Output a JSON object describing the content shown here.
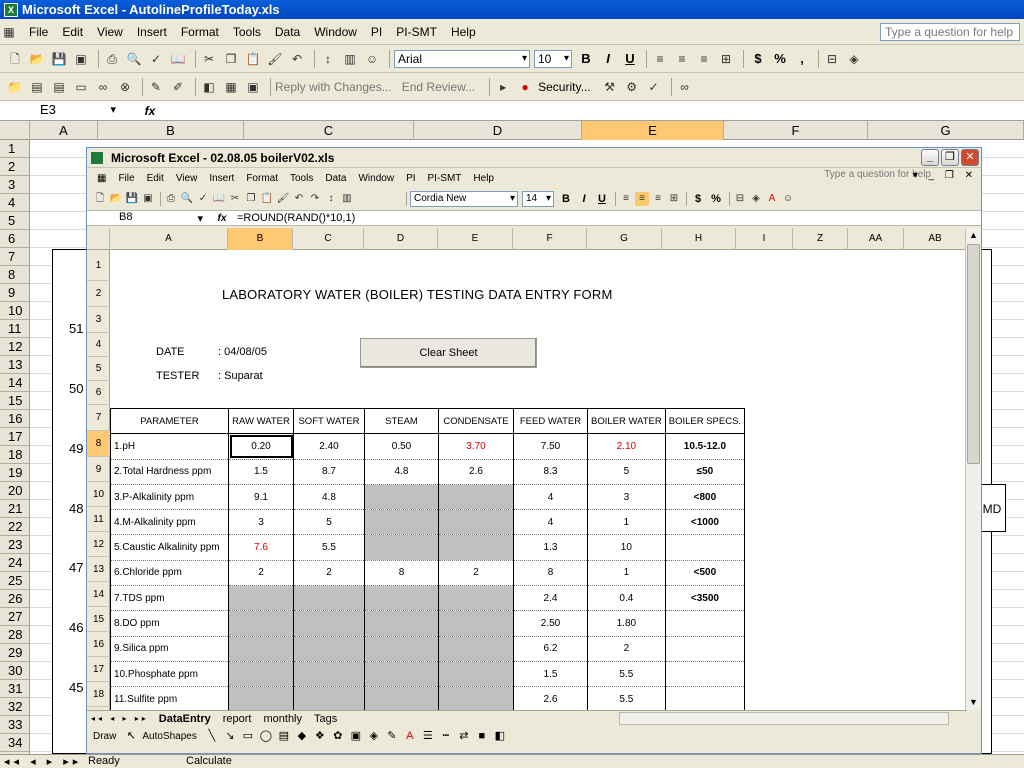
{
  "outer": {
    "title": "Microsoft Excel - AutolineProfileToday.xls",
    "menu": [
      "File",
      "Edit",
      "View",
      "Insert",
      "Format",
      "Tools",
      "Data",
      "Window",
      "PI",
      "PI-SMT",
      "Help"
    ],
    "ask_placeholder": "Type a question for help",
    "font": "Arial",
    "font_size": "10",
    "review": {
      "reply": "Reply with Changes...",
      "end_review": "End Review..."
    },
    "security": "Security...",
    "name_box": "E3",
    "fx": "fx",
    "columns": [
      "A",
      "B",
      "C",
      "D",
      "E",
      "F",
      "G"
    ],
    "rows": [
      "1",
      "2",
      "3",
      "4",
      "5",
      "6",
      "7",
      "8",
      "9",
      "10",
      "11",
      "12",
      "13",
      "14",
      "15",
      "16",
      "17",
      "18",
      "19",
      "20",
      "21",
      "22",
      "23",
      "24",
      "25",
      "26",
      "27",
      "28",
      "29",
      "30",
      "31",
      "32",
      "33",
      "34"
    ],
    "chart_y_labels": [
      "51",
      "50",
      "49",
      "48",
      "47",
      "46",
      "45"
    ],
    "md_label": "MD",
    "status": "Ready",
    "calc": "Calculate"
  },
  "inner": {
    "title": "Microsoft Excel - 02.08.05 boilerV02.xls",
    "menu": [
      "File",
      "Edit",
      "View",
      "Insert",
      "Format",
      "Tools",
      "Data",
      "Window",
      "PI",
      "PI-SMT",
      "Help"
    ],
    "ask_placeholder": "Type a question for help",
    "font": "Cordia New",
    "font_size": "14",
    "name_box": "B8",
    "formula": "=ROUND(RAND()*10,1)",
    "columns": [
      "A",
      "B",
      "C",
      "D",
      "E",
      "F",
      "G",
      "H",
      "I",
      "Z",
      "AA",
      "AB"
    ],
    "rows": [
      "1",
      "2",
      "3",
      "4",
      "5",
      "6",
      "7",
      "8",
      "9",
      "10",
      "11",
      "12",
      "13",
      "14",
      "15",
      "16",
      "17",
      "18"
    ],
    "form_title": "LABORATORY WATER (BOILER) TESTING DATA ENTRY FORM",
    "date_label": "DATE",
    "date_value": ":  04/08/05",
    "tester_label": "TESTER",
    "tester_value": ":  Suparat",
    "clear_button": "Clear Sheet",
    "table": {
      "headers": [
        "PARAMETER",
        "RAW WATER",
        "SOFT WATER",
        "STEAM",
        "CONDENSATE",
        "FEED WATER",
        "BOILER WATER",
        "BOILER SPECS."
      ],
      "rows": [
        {
          "param": "1.pH",
          "raw": "0.20",
          "soft": "2.40",
          "steam": "0.50",
          "cond": "3.70",
          "feed": "7.50",
          "boiler": "2.10",
          "spec": "10.5-12.0"
        },
        {
          "param": "2.Total Hardness   ppm",
          "raw": "1.5",
          "soft": "8.7",
          "steam": "4.8",
          "cond": "2.6",
          "feed": "8.3",
          "boiler": "5",
          "spec": "≤50"
        },
        {
          "param": "3.P-Alkalinity        ppm",
          "raw": "9.1",
          "soft": "4.8",
          "steam": "",
          "cond": "",
          "feed": "4",
          "boiler": "3",
          "spec": "<800"
        },
        {
          "param": "4.M-Alkalinity        ppm",
          "raw": "3",
          "soft": "5",
          "steam": "",
          "cond": "",
          "feed": "4",
          "boiler": "1",
          "spec": "<1000"
        },
        {
          "param": "5.Caustic Alkalinity ppm",
          "raw": "7.6",
          "soft": "5.5",
          "steam": "",
          "cond": "",
          "feed": "1.3",
          "boiler": "10",
          "spec": ""
        },
        {
          "param": "6.Chloride             ppm",
          "raw": "2",
          "soft": "2",
          "steam": "8",
          "cond": "2",
          "feed": "8",
          "boiler": "1",
          "spec": "<500"
        },
        {
          "param": "7.TDS                    ppm",
          "raw": "",
          "soft": "",
          "steam": "",
          "cond": "",
          "feed": "2.4",
          "boiler": "0.4",
          "spec": "<3500"
        },
        {
          "param": "8.DO                     ppm",
          "raw": "",
          "soft": "",
          "steam": "",
          "cond": "",
          "feed": "2.50",
          "boiler": "1.80",
          "spec": ""
        },
        {
          "param": "9.Silica             ppm",
          "raw": "",
          "soft": "",
          "steam": "",
          "cond": "",
          "feed": "6.2",
          "boiler": "2",
          "spec": ""
        },
        {
          "param": "10.Phosphate     ppm",
          "raw": "",
          "soft": "",
          "steam": "",
          "cond": "",
          "feed": "1.5",
          "boiler": "5.5",
          "spec": ""
        },
        {
          "param": "11.Sulfite           ppm",
          "raw": "",
          "soft": "",
          "steam": "",
          "cond": "",
          "feed": "2.6",
          "boiler": "5.5",
          "spec": ""
        }
      ]
    },
    "sheet_tabs": [
      "DataEntry",
      "report",
      "monthly",
      "Tags"
    ],
    "draw_label": "Draw",
    "autoshapes_label": "AutoShapes"
  },
  "colors": {
    "red_text": "#e00000",
    "grey_cell": "#c0c0c0",
    "selected_header": "#ffc873",
    "titlebar_blue": "#0246c0"
  }
}
